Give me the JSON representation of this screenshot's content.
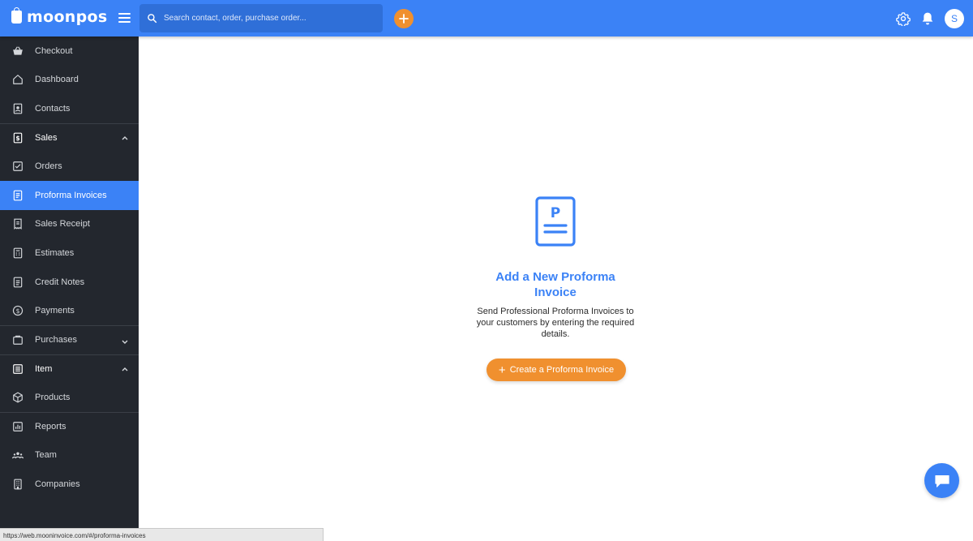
{
  "app": {
    "name": "moonpos"
  },
  "search": {
    "placeholder": "Search contact, order, purchase order..."
  },
  "header": {
    "avatar_initial": "S"
  },
  "sidebar": {
    "items": [
      {
        "label": "Checkout",
        "icon": "basket-icon"
      },
      {
        "label": "Dashboard",
        "icon": "home-icon"
      },
      {
        "label": "Contacts",
        "icon": "contacts-icon"
      },
      {
        "label": "Sales",
        "icon": "dollar-doc-icon",
        "group": true,
        "expanded": true
      },
      {
        "label": "Orders",
        "icon": "check-square-icon"
      },
      {
        "label": "Proforma Invoices",
        "icon": "invoice-icon",
        "active": true
      },
      {
        "label": "Sales Receipt",
        "icon": "receipt-icon"
      },
      {
        "label": "Estimates",
        "icon": "calculator-icon"
      },
      {
        "label": "Credit Notes",
        "icon": "note-icon"
      },
      {
        "label": "Payments",
        "icon": "coin-icon"
      },
      {
        "label": "Purchases",
        "icon": "purchase-icon",
        "group": true,
        "expanded": false
      },
      {
        "label": "Item",
        "icon": "list-icon",
        "group": true,
        "expanded": true
      },
      {
        "label": "Products",
        "icon": "box-icon"
      },
      {
        "label": "Reports",
        "icon": "bar-chart-icon",
        "group": true
      },
      {
        "label": "Team",
        "icon": "team-icon"
      },
      {
        "label": "Companies",
        "icon": "building-icon"
      }
    ]
  },
  "main": {
    "empty_icon_letter": "P",
    "title": "Add a New Proforma Invoice",
    "description": "Send Professional Proforma Invoices to your customers by entering the required details.",
    "create_button": "Create a Proforma Invoice"
  },
  "statusbar": {
    "url": "https://web.mooninvoice.com/#/proforma-invoices"
  },
  "colors": {
    "primary": "#3b82f6",
    "accent": "#f0902f",
    "sidebar": "#23272e"
  }
}
